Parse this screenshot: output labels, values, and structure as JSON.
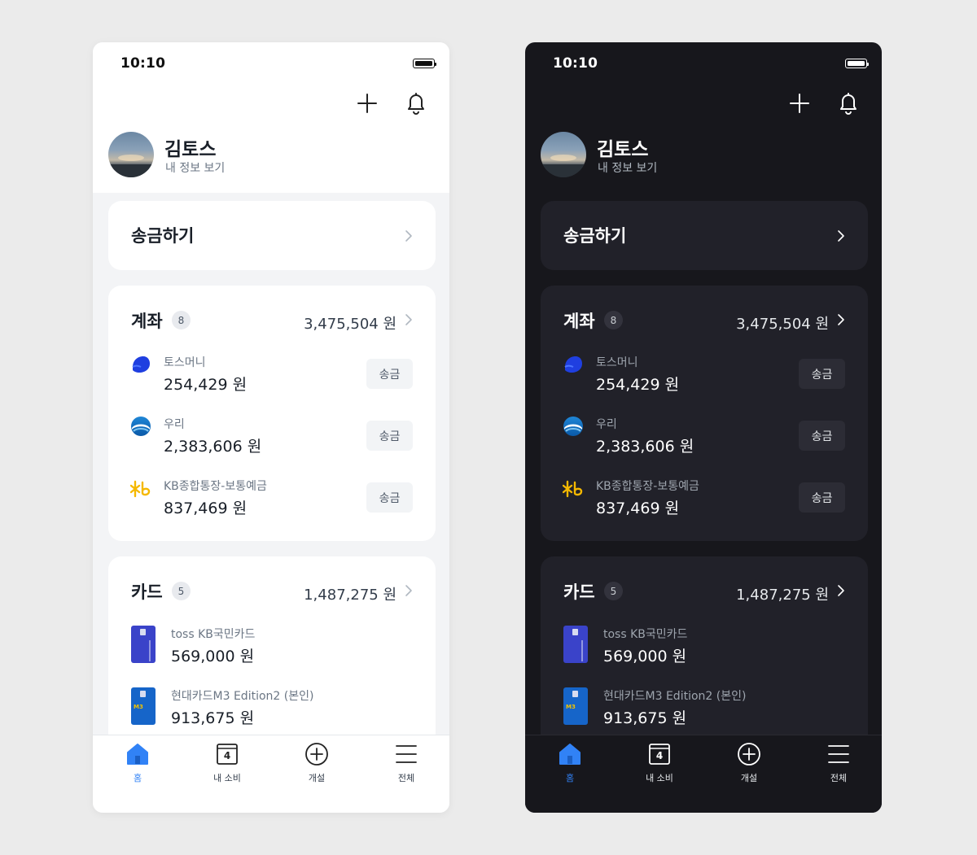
{
  "status": {
    "time": "10:10"
  },
  "profile": {
    "name": "김토스",
    "subtitle": "내 정보 보기"
  },
  "send": {
    "title": "송금하기"
  },
  "accounts": {
    "title": "계좌",
    "count": "8",
    "total": "3,475,504 원",
    "items": [
      {
        "name": "토스머니",
        "amount": "254,429 원",
        "action": "송금",
        "logo": "toss-logo-icon"
      },
      {
        "name": "우리",
        "amount": "2,383,606 원",
        "action": "송금",
        "logo": "woori-logo-icon"
      },
      {
        "name": "KB종합통장-보통예금",
        "amount": "837,469 원",
        "action": "송금",
        "logo": "kb-logo-icon"
      }
    ]
  },
  "cards": {
    "title": "카드",
    "count": "5",
    "total": "1,487,275 원",
    "items": [
      {
        "name": "toss KB국민카드",
        "amount": "569,000 원",
        "thumb": "toss-card-thumbnail"
      },
      {
        "name": "현대카드M3 Edition2 (본인)",
        "amount": "913,675 원",
        "thumb": "m3-card-thumbnail",
        "badge": "M3"
      }
    ]
  },
  "tabbar": {
    "items": [
      {
        "label": "홈",
        "icon": "home-icon",
        "active": true
      },
      {
        "label": "내 소비",
        "icon": "calendar-icon",
        "calendar_day": "4"
      },
      {
        "label": "개설",
        "icon": "plus-circle-icon"
      },
      {
        "label": "전체",
        "icon": "menu-icon"
      }
    ]
  },
  "colors": {
    "accent": "#3182f6",
    "light_background": "#f3f4f6",
    "dark_background": "#17171c",
    "light_card": "#ffffff",
    "dark_card": "#212129",
    "page_background": "#ebebeb"
  }
}
